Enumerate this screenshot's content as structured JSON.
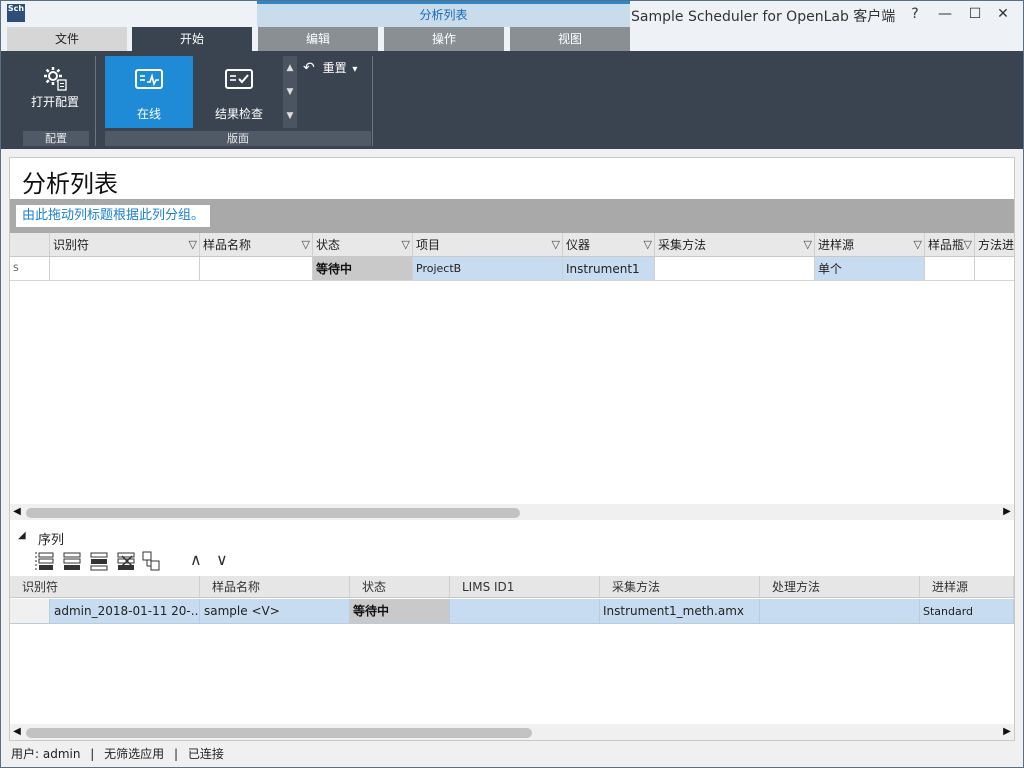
{
  "window": {
    "app_icon_text": "Sch",
    "context_tab": "分析列表",
    "title": "Sample Scheduler for OpenLab 客户端",
    "help": "?",
    "minimize": "—",
    "maximize": "☐",
    "close": "✕"
  },
  "ribbon_tabs": [
    "文件",
    "开始",
    "编辑",
    "操作",
    "视图"
  ],
  "ribbon": {
    "config_group": {
      "label": "配置",
      "open_config": "打开配置"
    },
    "layout_group": {
      "label": "版面",
      "online": "在线",
      "result_review": "结果检查"
    },
    "reset": "重置"
  },
  "page": {
    "title": "分析列表",
    "group_hint": "由此拖动列标题根据此列分组。"
  },
  "analysis_grid": {
    "columns": [
      "识别符",
      "样品名称",
      "状态",
      "项目",
      "仪器",
      "采集方法",
      "进样源",
      "样品瓶",
      "方法进"
    ],
    "rows": [
      {
        "marker": "S",
        "id": "",
        "sample": "",
        "status": "等待中",
        "project": "ProjectB",
        "instrument": "Instrument1",
        "acq_method": "",
        "injection_source": "单个",
        "vial": "",
        "method": ""
      }
    ]
  },
  "sequence": {
    "title": "序列",
    "toolbar_icons": [
      "insert-row-icon",
      "insert-above-icon",
      "insert-below-icon",
      "delete-row-icon",
      "copy-row-icon",
      "move-up-icon",
      "move-down-icon"
    ],
    "columns": [
      "识别符",
      "样品名称",
      "状态",
      "LIMS ID1",
      "采集方法",
      "处理方法",
      "进样源"
    ],
    "rows": [
      {
        "id": "admin_2018-01-11 20-...",
        "sample": "sample <V>",
        "status": "等待中",
        "lims": "",
        "acq_method": "Instrument1_meth.amx",
        "proc_method": "",
        "injection_source": "Standard"
      }
    ]
  },
  "statusbar": {
    "user": "用户: admin",
    "filter": "无筛选应用",
    "connection": "已连接",
    "separator": "|"
  },
  "colors": {
    "ribbon_bg": "#3a4450",
    "accent_blue": "#1f8ad6",
    "row_selected": "#c7dcf0",
    "status_waiting_bg": "#c9c9c9"
  }
}
